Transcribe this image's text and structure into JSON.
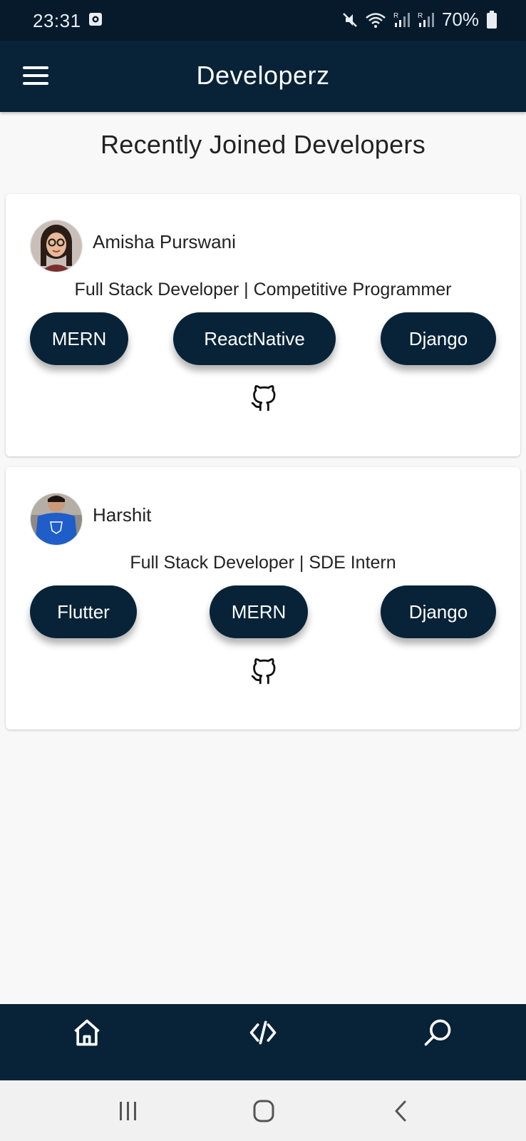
{
  "status_bar": {
    "time": "23:31",
    "battery": "70%",
    "icons": [
      "app-notification-icon",
      "mute-icon",
      "wifi-icon",
      "signal-icon",
      "signal-icon",
      "battery-icon"
    ]
  },
  "app_bar": {
    "title": "Developerz",
    "menu_icon": "hamburger-menu-icon"
  },
  "section_title": "Recently Joined Developers",
  "developers": [
    {
      "name": "Amisha Purswani",
      "bio": "Full Stack Developer | Competitive Programmer",
      "skills": [
        "MERN",
        "ReactNative",
        "Django"
      ],
      "github_icon": "github-icon"
    },
    {
      "name": "Harshit",
      "bio": "Full Stack Developer | SDE Intern",
      "skills": [
        "Flutter",
        "MERN",
        "Django"
      ],
      "github_icon": "github-icon"
    }
  ],
  "bottom_nav": {
    "items": [
      "home-icon",
      "code-icon",
      "search-icon"
    ]
  },
  "system_nav": {
    "items": [
      "recent-apps-icon",
      "home-circle-icon",
      "back-icon"
    ]
  },
  "colors": {
    "primary": "#082338",
    "status_bar": "#061a2b",
    "background": "#f8f8f8",
    "card": "#ffffff",
    "chip_text": "#ffffff"
  }
}
